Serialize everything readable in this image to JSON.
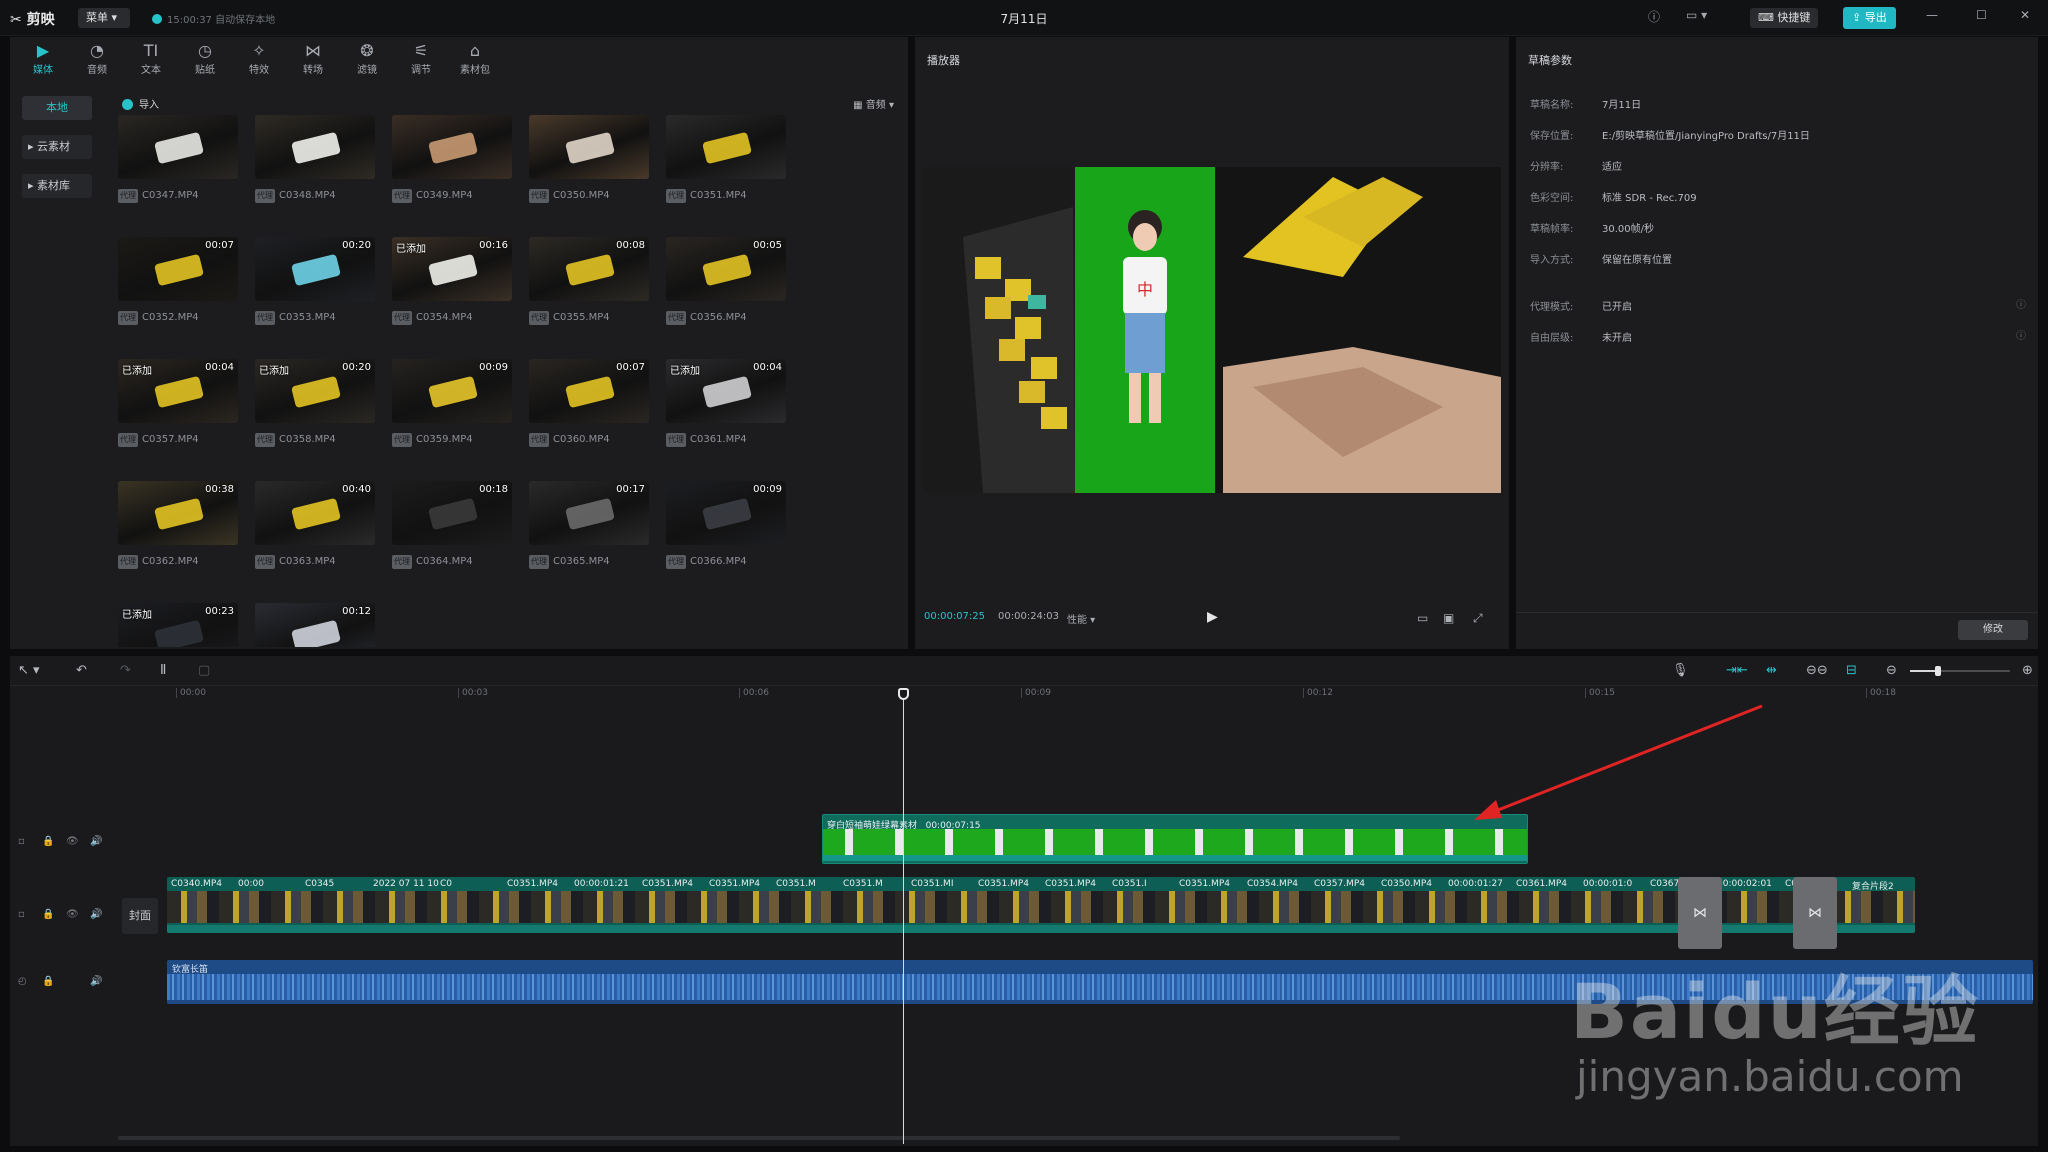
{
  "topbar": {
    "app_name": "剪映",
    "menu_label": "菜单",
    "autosave_text": "15:00:37 自动保存本地",
    "doc_title": "7月11日",
    "shortcut_label": "快捷键",
    "export_label": "导出",
    "icons": [
      "help-icon",
      "layout-icon",
      "minimize-icon",
      "maximize-icon",
      "close-icon"
    ]
  },
  "toolbar": {
    "tabs": [
      {
        "label": "媒体",
        "icon": "media-icon",
        "active": true
      },
      {
        "label": "音频",
        "icon": "audio-icon"
      },
      {
        "label": "文本",
        "icon": "text-icon"
      },
      {
        "label": "贴纸",
        "icon": "sticker-icon"
      },
      {
        "label": "特效",
        "icon": "effects-icon"
      },
      {
        "label": "转场",
        "icon": "transition-icon"
      },
      {
        "label": "滤镜",
        "icon": "filter-icon"
      },
      {
        "label": "调节",
        "icon": "adjust-icon"
      },
      {
        "label": "素材包",
        "icon": "package-icon"
      }
    ]
  },
  "sidebar": {
    "items": [
      {
        "label": "本地",
        "active": true
      },
      {
        "label": "▸ 云素材"
      },
      {
        "label": "▸ 素材库"
      }
    ]
  },
  "media": {
    "import_label": "导入",
    "sort_label": "音频 ▾",
    "proxy_badge": "代理",
    "added_label": "已添加",
    "items": [
      {
        "name": "C0347.MP4",
        "duration": "",
        "added": false
      },
      {
        "name": "C0348.MP4",
        "duration": "",
        "added": false
      },
      {
        "name": "C0349.MP4",
        "duration": "",
        "added": false
      },
      {
        "name": "C0350.MP4",
        "duration": "",
        "added": false
      },
      {
        "name": "C0351.MP4",
        "duration": "",
        "added": false
      },
      {
        "name": "C0352.MP4",
        "duration": "00:07",
        "added": false
      },
      {
        "name": "C0353.MP4",
        "duration": "00:20",
        "added": false
      },
      {
        "name": "C0354.MP4",
        "duration": "00:16",
        "added": true
      },
      {
        "name": "C0355.MP4",
        "duration": "00:08",
        "added": false
      },
      {
        "name": "C0356.MP4",
        "duration": "00:05",
        "added": false
      },
      {
        "name": "C0357.MP4",
        "duration": "00:04",
        "added": true
      },
      {
        "name": "C0358.MP4",
        "duration": "00:20",
        "added": true
      },
      {
        "name": "C0359.MP4",
        "duration": "00:09",
        "added": false
      },
      {
        "name": "C0360.MP4",
        "duration": "00:07",
        "added": false
      },
      {
        "name": "C0361.MP4",
        "duration": "00:04",
        "added": true
      },
      {
        "name": "C0362.MP4",
        "duration": "00:38",
        "added": false
      },
      {
        "name": "C0363.MP4",
        "duration": "00:40",
        "added": false
      },
      {
        "name": "C0364.MP4",
        "duration": "00:18",
        "added": false
      },
      {
        "name": "C0365.MP4",
        "duration": "00:17",
        "added": false
      },
      {
        "name": "C0366.MP4",
        "duration": "00:09",
        "added": false
      },
      {
        "name": "",
        "duration": "00:23",
        "added": true
      },
      {
        "name": "",
        "duration": "00:12",
        "added": false
      }
    ]
  },
  "player": {
    "title": "播放器",
    "current_time": "00:00:07:25",
    "total_time": "00:00:24:03",
    "perf_label": "性能 ▾"
  },
  "props": {
    "title": "草稿参数",
    "rows": [
      {
        "key": "草稿名称:",
        "value": "7月11日"
      },
      {
        "key": "保存位置:",
        "value": "E:/剪映草稿位置/JianyingPro Drafts/7月11日"
      },
      {
        "key": "分辨率:",
        "value": "适应"
      },
      {
        "key": "色彩空间:",
        "value": "标准 SDR - Rec.709"
      },
      {
        "key": "草稿帧率:",
        "value": "30.00帧/秒"
      },
      {
        "key": "导入方式:",
        "value": "保留在原有位置"
      },
      {
        "key": "代理模式:",
        "value": "已开启"
      },
      {
        "key": "自由层级:",
        "value": "未开启"
      }
    ],
    "modify_label": "修改"
  },
  "timeline": {
    "ruler_ticks": [
      "00:00",
      "00:03",
      "00:06",
      "00:09",
      "00:12",
      "00:15",
      "00:18"
    ],
    "cover_label": "封面",
    "overlay_clip": {
      "name": "穿白短袖萌娃绿幕素材",
      "duration": "00:00:07:15"
    },
    "main_segments": [
      "C0340.MP4",
      "00:00",
      "C0345",
      "2022 07 11 10",
      "C0",
      "C0351.MP4",
      "00:00:01:21",
      "C0351.MP4",
      "C0351.MP4",
      "C0351.M",
      "C0351.M",
      "C0351.MI",
      "C0351.MP4",
      "C0351.MP4",
      "C0351.I",
      "C0351.MP4",
      "C0354.MP4",
      "C0357.MP4",
      "C0350.MP4",
      "00:00:01:27",
      "C0361.MP4",
      "00:00:01:0",
      "C0367.MP4",
      "00:00:02:01",
      "C0367.MP4",
      "复合片段2"
    ],
    "audio_label": "钦富长笛"
  },
  "watermark": {
    "big": "Baidu经验",
    "small": "jingyan.baidu.com"
  },
  "colors": {
    "accent": "#27c3c8",
    "overlay_clip": "#0f6b5c",
    "audio_clip": "#1e4a86",
    "arrow": "#e02424"
  }
}
